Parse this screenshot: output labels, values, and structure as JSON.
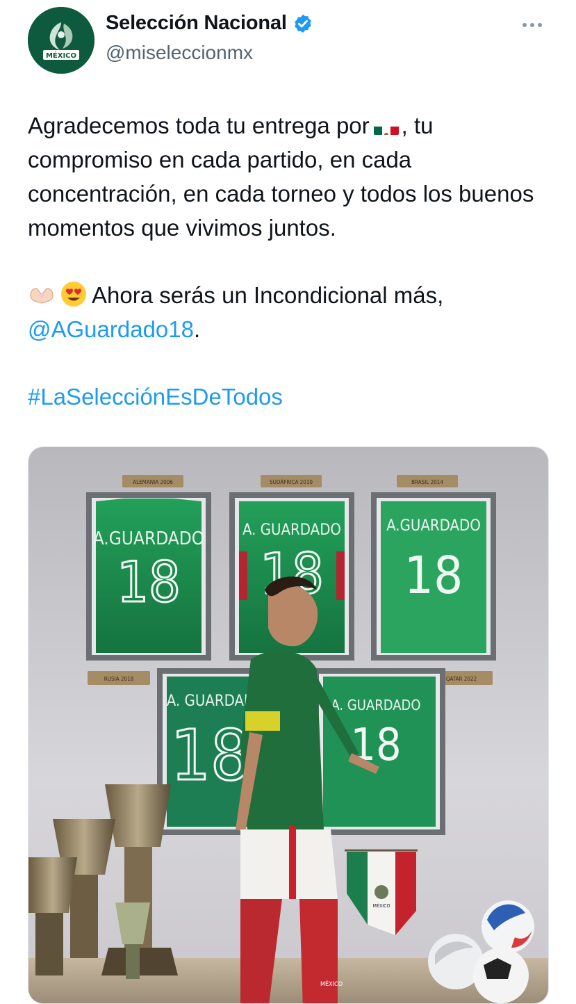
{
  "author": {
    "display_name": "Selección Nacional",
    "handle": "@miseleccionmx",
    "avatar_text": "MÉXICO",
    "verified": true
  },
  "tweet": {
    "para1_before_flag": "Agradecemos toda tu entrega por",
    "para1_after_flag": ", tu compromiso en cada partido, en cada concentración, en cada torneo y todos los buenos momentos que vivimos juntos.",
    "para2_text": "Ahora serás un Incondicional más,",
    "mention": "@AGuardado18",
    "period": ".",
    "hashtag": "#LaSelecciónEsDeTodos",
    "emojis": [
      "heart-hands-emoji",
      "heart-eyes-emoji"
    ],
    "flag": "mexico-flag"
  },
  "media": {
    "plaques": [
      "ALEMANIA 2006",
      "SUDÁFRICA 2010",
      "BRASIL 2014",
      "RUSIA 2018",
      "QATAR 2022"
    ],
    "jerseys": [
      {
        "name": "A.GUARDADO",
        "number": "18"
      },
      {
        "name": "A. GUARDADO",
        "number": "18"
      },
      {
        "name": "A.GUARDADO",
        "number": "18"
      },
      {
        "name": "A. GUARDAD",
        "number": "18"
      },
      {
        "name": "A. GUARDADO",
        "number": "18"
      }
    ],
    "pennant_text": "MÉXICO",
    "shorts_text": "MÉXICO"
  },
  "colors": {
    "link": "#1d9bf0",
    "verified": "#1d9bf0",
    "jersey_green": "#1d8a4e",
    "avatar_bg": "#0e5a3f"
  }
}
